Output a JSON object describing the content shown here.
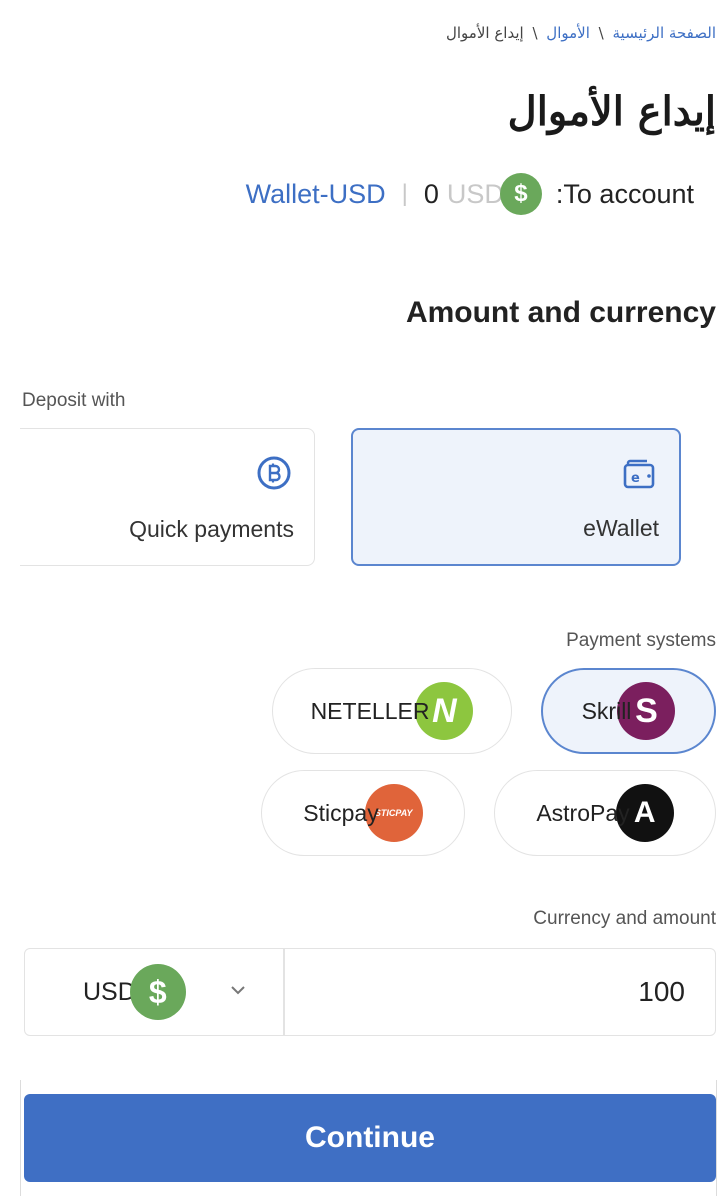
{
  "breadcrumb": {
    "home": "الصفحة الرئيسية",
    "funds": "الأموال",
    "current": "إيداع الأموال",
    "separator": "\\"
  },
  "page_title": "إيداع الأموال",
  "account": {
    "label": ":To account",
    "currency": "USD",
    "balance": "0",
    "wallet": "Wallet-USD",
    "coin_symbol": "$"
  },
  "section_title": "Amount and currency",
  "deposit": {
    "label": "Deposit with",
    "methods": [
      {
        "label": "Quick payments",
        "icon": "bitcoin-icon",
        "selected": false
      },
      {
        "label": "eWallet",
        "icon": "wallet-icon",
        "selected": true
      }
    ]
  },
  "payment_systems": {
    "label": "Payment systems",
    "items": [
      {
        "name": "Skrill",
        "logo_letter": "S",
        "color": "#7b1f5e",
        "selected": true
      },
      {
        "name": "NETELLER",
        "logo_letter": "N",
        "color": "#8dc63f",
        "selected": false
      },
      {
        "name": "AstroPay",
        "logo_letter": "A",
        "color": "#111111",
        "selected": false
      },
      {
        "name": "Sticpay",
        "logo_letter": "STICPAY",
        "color": "#e0643a",
        "selected": false
      }
    ]
  },
  "amount": {
    "label": "Currency and amount",
    "currency": "USD",
    "coin_symbol": "$",
    "value": "100"
  },
  "continue_label": "Continue",
  "colors": {
    "accent": "#3f6fc4",
    "link": "#3d6fc4",
    "usd_coin": "#6aa85b"
  }
}
